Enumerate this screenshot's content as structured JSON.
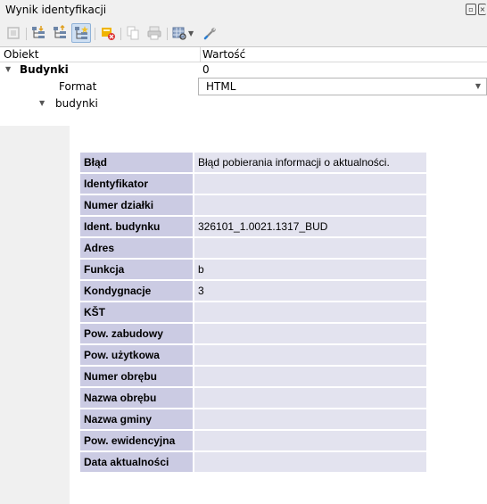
{
  "panel": {
    "title": "Wynik identyfikacji"
  },
  "toolbar": {
    "icons": [
      "identify-icon",
      "expand-tree-icon",
      "collapse-tree-icon",
      "expand-new-icon",
      "clear-results-icon",
      "copy-icon",
      "print-icon",
      "identify-mode-icon",
      "settings-icon"
    ]
  },
  "tree": {
    "headers": {
      "feature": "Obiekt",
      "value": "Wartość"
    },
    "layer": {
      "name": "Budynki",
      "count": "0"
    },
    "format": {
      "label": "Format",
      "value": "HTML"
    },
    "feature": {
      "name": "budynki"
    }
  },
  "attributes": [
    {
      "key": "Błąd",
      "value": "Błąd pobierania informacji o aktualności."
    },
    {
      "key": "Identyfikator",
      "value": ""
    },
    {
      "key": "Numer działki",
      "value": ""
    },
    {
      "key": "Ident. budynku",
      "value": "326101_1.0021.1317_BUD"
    },
    {
      "key": "Adres",
      "value": ""
    },
    {
      "key": "Funkcja",
      "value": "b"
    },
    {
      "key": "Kondygnacje",
      "value": "3"
    },
    {
      "key": "KŠT",
      "value": ""
    },
    {
      "key": "Pow. zabudowy",
      "value": ""
    },
    {
      "key": "Pow. użytkowa",
      "value": ""
    },
    {
      "key": "Numer obrębu",
      "value": ""
    },
    {
      "key": "Nazwa obrębu",
      "value": ""
    },
    {
      "key": "Nazwa gminy",
      "value": ""
    },
    {
      "key": "Pow. ewidencyjna",
      "value": ""
    },
    {
      "key": "Data aktualności",
      "value": ""
    }
  ],
  "colors": {
    "key_cell": "#cbcbe3",
    "value_cell": "#e3e3ef",
    "active_tool": "#cfe0f3"
  }
}
